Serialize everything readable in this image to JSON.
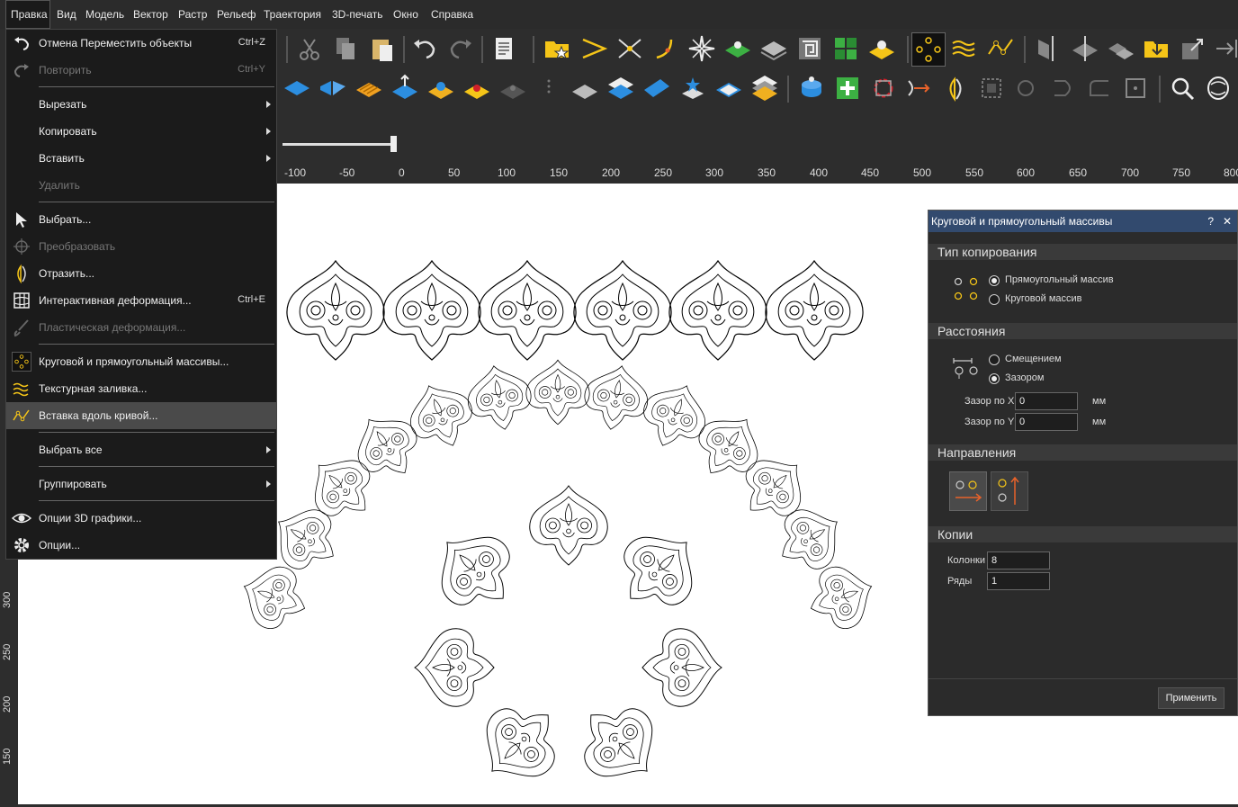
{
  "menubar": [
    "Правка",
    "Вид",
    "Модель",
    "Вектор",
    "Растр",
    "Рельеф",
    "Траектория",
    "3D-печать",
    "Окно",
    "Справка"
  ],
  "ruler": {
    "h": [
      "-100",
      "-50",
      "0",
      "50",
      "100",
      "150",
      "200",
      "250",
      "300",
      "350",
      "400",
      "450",
      "500",
      "550",
      "600",
      "650",
      "700",
      "750",
      "800"
    ],
    "v": [
      "300",
      "250",
      "200",
      "150"
    ]
  },
  "menu": {
    "undo": {
      "label": "Отмена Переместить объекты",
      "shortcut": "Ctrl+Z"
    },
    "redo": {
      "label": "Повторить",
      "shortcut": "Ctrl+Y"
    },
    "cut": "Вырезать",
    "copy": "Копировать",
    "paste": "Вставить",
    "delete": "Удалить",
    "select": "Выбрать...",
    "transform": "Преобразовать",
    "mirror": "Отразить...",
    "interactive_warp": {
      "label": "Интерактивная деформация...",
      "shortcut": "Ctrl+E"
    },
    "plastic_warp": "Пластическая деформация...",
    "arrays": "Круговой и прямоугольный массивы...",
    "texture_fill": "Текстурная заливка...",
    "paste_along_curve": "Вставка вдоль кривой...",
    "select_all": "Выбрать все",
    "group": "Группировать",
    "options_3d": "Опции 3D графики...",
    "options": "Опции..."
  },
  "panel": {
    "title": "Круговой и прямоугольный массивы",
    "help": "?",
    "close": "✕",
    "copy_type": {
      "title": "Тип копирования",
      "rect": "Прямоугольный массив",
      "circ": "Круговой массив",
      "selected": "rect"
    },
    "distances": {
      "title": "Расстояния",
      "offset": "Смещением",
      "gap": "Зазором",
      "selected": "gap",
      "gap_x_label": "Зазор по X",
      "gap_x": "0",
      "gap_y_label": "Зазор по Y",
      "gap_y": "0",
      "unit": "мм"
    },
    "directions": {
      "title": "Направления"
    },
    "copies": {
      "title": "Копии",
      "cols_label": "Колонки",
      "cols": "8",
      "rows_label": "Ряды",
      "rows": "1"
    },
    "apply": "Применить"
  },
  "colors": {
    "accent": "#f5c518",
    "titlebar": "#324a6e",
    "orange": "#e8622a"
  }
}
